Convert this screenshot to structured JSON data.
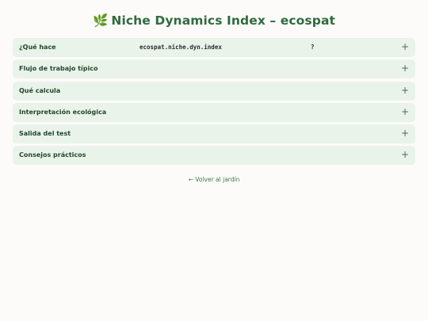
{
  "page": {
    "title_icon": "🌿",
    "title": "Niche Dynamics Index – ecospat"
  },
  "accordion": {
    "items": [
      {
        "label": "¿Qué hace",
        "code": "ecospat.niche.dyn.index",
        "code_suffix": "?",
        "icon": "plus-icon"
      },
      {
        "label": "Flujo de trabajo típico",
        "icon": "plus-icon"
      },
      {
        "label": "Qué calcula",
        "icon": "plus-icon"
      },
      {
        "label": "Interpretación ecológica",
        "icon": "plus-icon"
      },
      {
        "label": "Salida del test",
        "icon": "plus-icon"
      },
      {
        "label": "Consejos prácticos",
        "icon": "plus-icon"
      }
    ],
    "toggle_symbol": "+"
  },
  "footer": {
    "back_link": "← Volver al jardín"
  },
  "colors": {
    "background": "#fcfbf9",
    "title": "#2f6b3f",
    "item_background": "#e9f3ea",
    "link": "#3d7a4c"
  }
}
